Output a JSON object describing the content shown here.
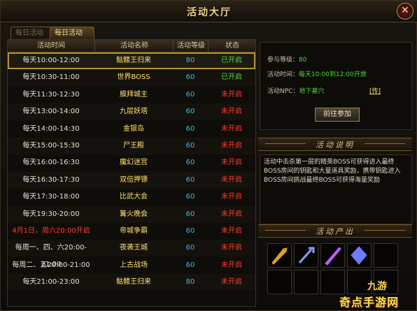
{
  "title": "活动大厅",
  "tabs": [
    {
      "label": "每日活动"
    },
    {
      "label": "每日活动"
    }
  ],
  "table": {
    "headers": [
      "活动时间",
      "活动名称",
      "活动等级",
      "状态"
    ],
    "rows": [
      {
        "time": "每天10:00-12:00",
        "name": "骷髅王归来",
        "level": "80",
        "status": "已开启"
      },
      {
        "time": "每天10:30-11:00",
        "name": "世界BOSS",
        "level": "60",
        "status": "已开启"
      },
      {
        "time": "每天11:30-12:30",
        "name": "膜拜城主",
        "level": "60",
        "status": "未开启"
      },
      {
        "time": "每天13:00-14:00",
        "name": "九层妖塔",
        "level": "60",
        "status": "未开启"
      },
      {
        "time": "每天14:00-14:30",
        "name": "金银岛",
        "level": "60",
        "status": "未开启"
      },
      {
        "time": "每天15:00-15:30",
        "name": "尸王殿",
        "level": "60",
        "status": "未开启"
      },
      {
        "time": "每天16:00-16:30",
        "name": "魔幻迷宫",
        "level": "60",
        "status": "未开启"
      },
      {
        "time": "每天16:30-17:30",
        "name": "双倍押镖",
        "level": "60",
        "status": "未开启"
      },
      {
        "time": "每天17:30-18:00",
        "name": "比武大会",
        "level": "60",
        "status": "未开启"
      },
      {
        "time": "每天19:30-20:00",
        "name": "篝火晚会",
        "level": "60",
        "status": "未开启"
      },
      {
        "time": "4月1日，周六20:00开启",
        "name": "帝城争霸",
        "level": "60",
        "status": "未开启"
      },
      {
        "time": "每周一、四、六20:00-21:00",
        "name": "夜袭王城",
        "level": "60",
        "status": "未开启"
      },
      {
        "time": "每周二、五20:00-21:00",
        "name": "上古战场",
        "level": "60",
        "status": "未开启"
      },
      {
        "time": "每天21:00-23:00",
        "name": "骷髅王归来",
        "level": "80",
        "status": "未开启"
      }
    ]
  },
  "detail": {
    "level_label": "参与等级：",
    "level_value": "80",
    "time_label": "活动时间：",
    "time_value": "每天10:00到12:00开放",
    "npc_label": "活动NPC：",
    "npc_value": "地下墓穴",
    "npc_link": "[传]",
    "go_button": "前往参加"
  },
  "desc_section": {
    "title": "活动说明",
    "text": "活动中击杀第一层的精英BOSS可获得进入最终BOSS房间的钥匙和大量道具奖励，携带钥匙进入BOSS房间挑战最终BOSS可获得海量奖励"
  },
  "reward_section": {
    "title": "活动产出",
    "items": [
      {
        "icon": "golden-sword-icon",
        "filled": true,
        "color": "#e0a020"
      },
      {
        "icon": "blue-staff-icon",
        "filled": true,
        "color": "#8aa0ff"
      },
      {
        "icon": "purple-blade-icon",
        "filled": true,
        "color": "#c060ff"
      },
      {
        "icon": "blue-crystal-icon",
        "filled": true,
        "color": "#6f7cff"
      },
      {
        "icon": "empty-slot",
        "filled": false
      },
      {
        "icon": "empty-slot",
        "filled": false
      },
      {
        "icon": "empty-slot",
        "filled": false
      },
      {
        "icon": "empty-slot",
        "filled": false
      },
      {
        "icon": "empty-slot",
        "filled": false
      },
      {
        "icon": "empty-slot",
        "filled": false
      }
    ]
  },
  "watermark": {
    "line1": "九游",
    "line2": "奇点手游网"
  },
  "colors": {
    "gold": "#ffe06b",
    "open": "#52d23d",
    "closed": "#ff3a2a",
    "level": "#3db8d6"
  }
}
